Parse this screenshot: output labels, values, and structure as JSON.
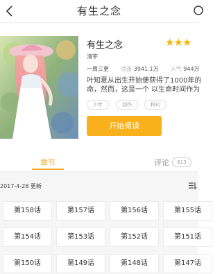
{
  "nav": {
    "title": "有生之念"
  },
  "book": {
    "title": "有生之念",
    "rating_stars": "★★★",
    "author": "清宇",
    "schedule": "一周三更",
    "hits_label": "点击",
    "hits_value": "3941.1万",
    "popularity_label": "人气",
    "popularity_value": "944万",
    "summary_line1": "叶知夏从出生开始便获得了1000年的",
    "summary_line2": "命，然而，这是一个 以生命时间作为",
    "tags": [
      "少年",
      "动作",
      "科幻"
    ],
    "read_button": "开始阅读"
  },
  "tabs": {
    "chapters_label": "章节",
    "comments_label": "评论",
    "comments_count": "613"
  },
  "chapters": {
    "update_text": "2017-4-28 更新",
    "items": [
      "第158话",
      "第157话",
      "第156话",
      "第155话",
      "第154话",
      "第153话",
      "第152话",
      "第151话",
      "第150话",
      "第149话",
      "第148话",
      "第147话"
    ]
  },
  "colors": {
    "accent": "#f8b01b",
    "tab_active": "#f5a623",
    "star": "#f7b500"
  }
}
